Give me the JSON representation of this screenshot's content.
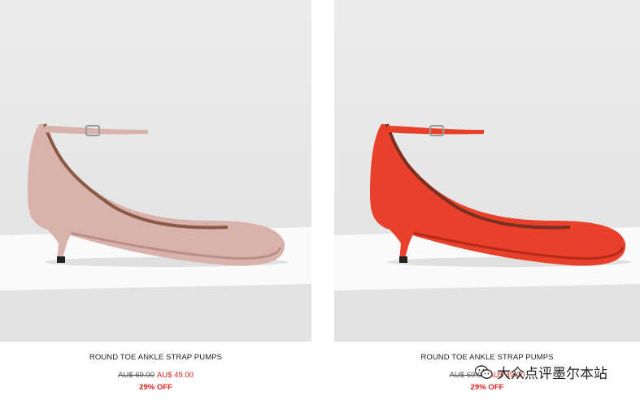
{
  "products": [
    {
      "name": "ROUND TOE ANKLE STRAP PUMPS",
      "old_price": "AU$ 69.00",
      "new_price": "AU$ 49.00",
      "discount": "29% OFF",
      "shoe_color": "#d9b2ab",
      "shoe_shadow": "#b98f89"
    },
    {
      "name": "ROUND TOE ANKLE STRAP PUMPS",
      "old_price": "AU$ 69.00",
      "new_price": "AU$ 49.00",
      "discount": "29% OFF",
      "shoe_color": "#e8402b",
      "shoe_shadow": "#b8281b"
    }
  ],
  "watermark": {
    "text": "大众点评墨尔本站",
    "icon": "wechat-icon"
  }
}
